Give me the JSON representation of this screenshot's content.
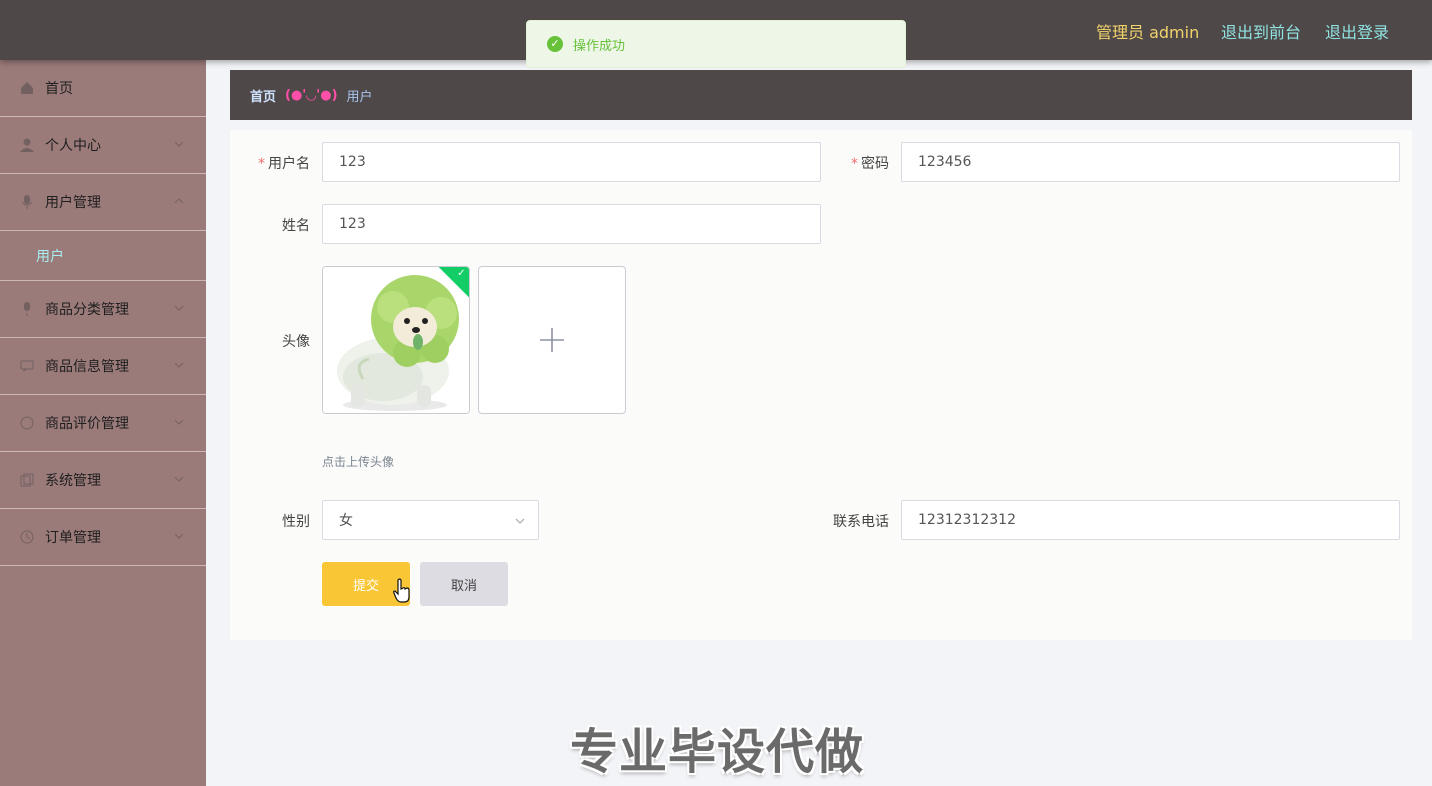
{
  "header": {
    "admin_label": "管理员 admin",
    "to_frontend": "退出到前台",
    "logout": "退出登录"
  },
  "toast": {
    "icon": "success-check-icon",
    "message": "操作成功"
  },
  "sidebar": {
    "items": [
      {
        "label": "首页",
        "icon": "home-icon"
      },
      {
        "label": "个人中心",
        "icon": "user-icon"
      },
      {
        "label": "用户管理",
        "icon": "mic-icon",
        "expanded": true
      },
      {
        "label": "商品分类管理",
        "icon": "mic-icon"
      },
      {
        "label": "商品信息管理",
        "icon": "chat-icon"
      },
      {
        "label": "商品评价管理",
        "icon": "circle-icon"
      },
      {
        "label": "系统管理",
        "icon": "copy-icon"
      },
      {
        "label": "订单管理",
        "icon": "clock-icon"
      }
    ],
    "subitem": "用户"
  },
  "breadcrumb": {
    "home": "首页",
    "separator": "(●'◡'●)",
    "current": "用户"
  },
  "form": {
    "username_label": "用户名",
    "username_value": "123",
    "password_label": "密码",
    "password_value": "123456",
    "name_label": "姓名",
    "name_value": "123",
    "avatar_label": "头像",
    "avatar_hint": "点击上传头像",
    "gender_label": "性别",
    "gender_value": "女",
    "phone_label": "联系电话",
    "phone_value": "12312312312",
    "required_mark": "*"
  },
  "buttons": {
    "submit": "提交",
    "cancel": "取消"
  },
  "watermark": "专业毕设代做",
  "colors": {
    "topbar": "#4f4848",
    "sidebar": "#9b7a7a",
    "submit": "#f9c735",
    "success": "#67c23a"
  }
}
